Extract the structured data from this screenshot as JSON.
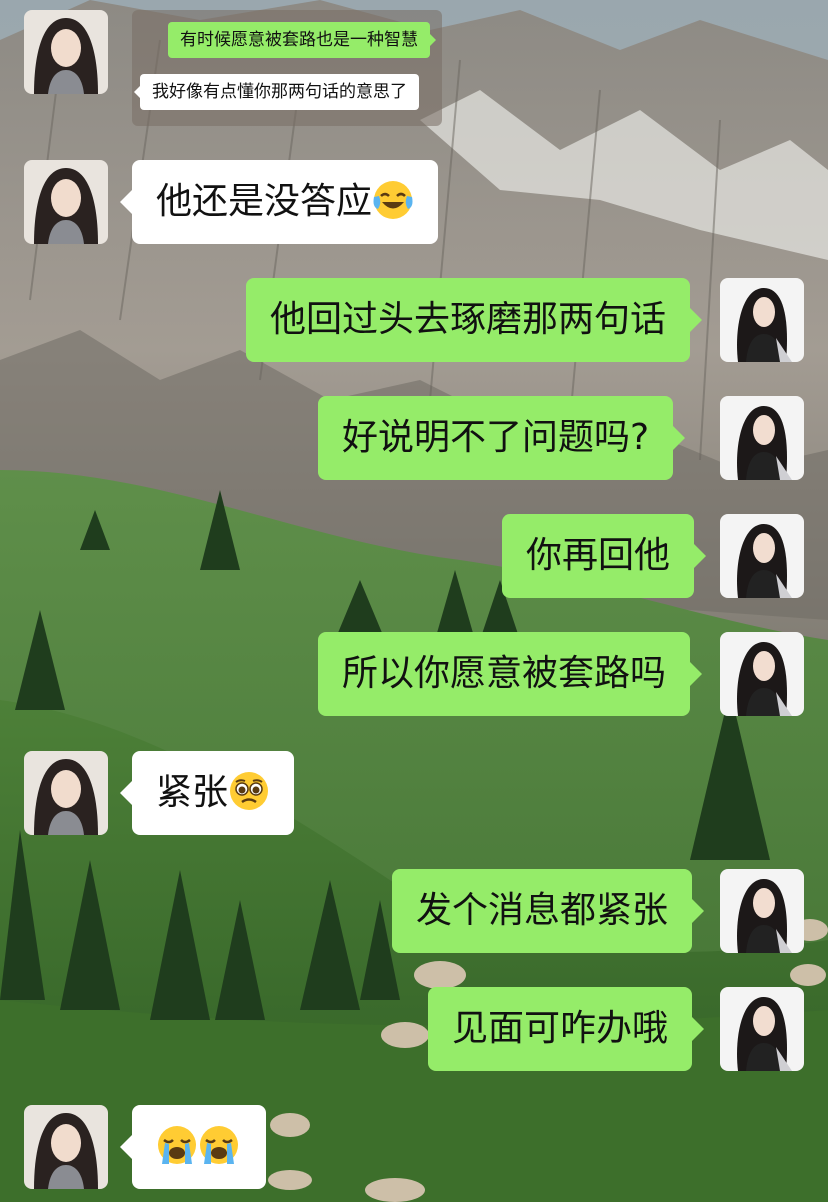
{
  "quoted_screenshot": {
    "sent": "有时候愿意被套路也是一种智慧",
    "received": "我好像有点懂你那两句话的意思了"
  },
  "messages": [
    {
      "side": "left",
      "text": "他还是没答应",
      "emoji": "tears-of-joy"
    },
    {
      "side": "right",
      "text": "他回过头去琢磨那两句话"
    },
    {
      "side": "right",
      "text": "好说明不了问题吗?"
    },
    {
      "side": "right",
      "text": "你再回他"
    },
    {
      "side": "right",
      "text": "所以你愿意被套路吗"
    },
    {
      "side": "left",
      "text": "紧张",
      "emoji": "pleading-face"
    },
    {
      "side": "right",
      "text": "发个消息都紧张"
    },
    {
      "side": "right",
      "text": "见面可咋办哦"
    },
    {
      "side": "left",
      "text": "",
      "emoji": "loudly-crying x2"
    }
  ],
  "colors": {
    "sent_bubble": "#95ec69",
    "received_bubble": "#ffffff"
  }
}
